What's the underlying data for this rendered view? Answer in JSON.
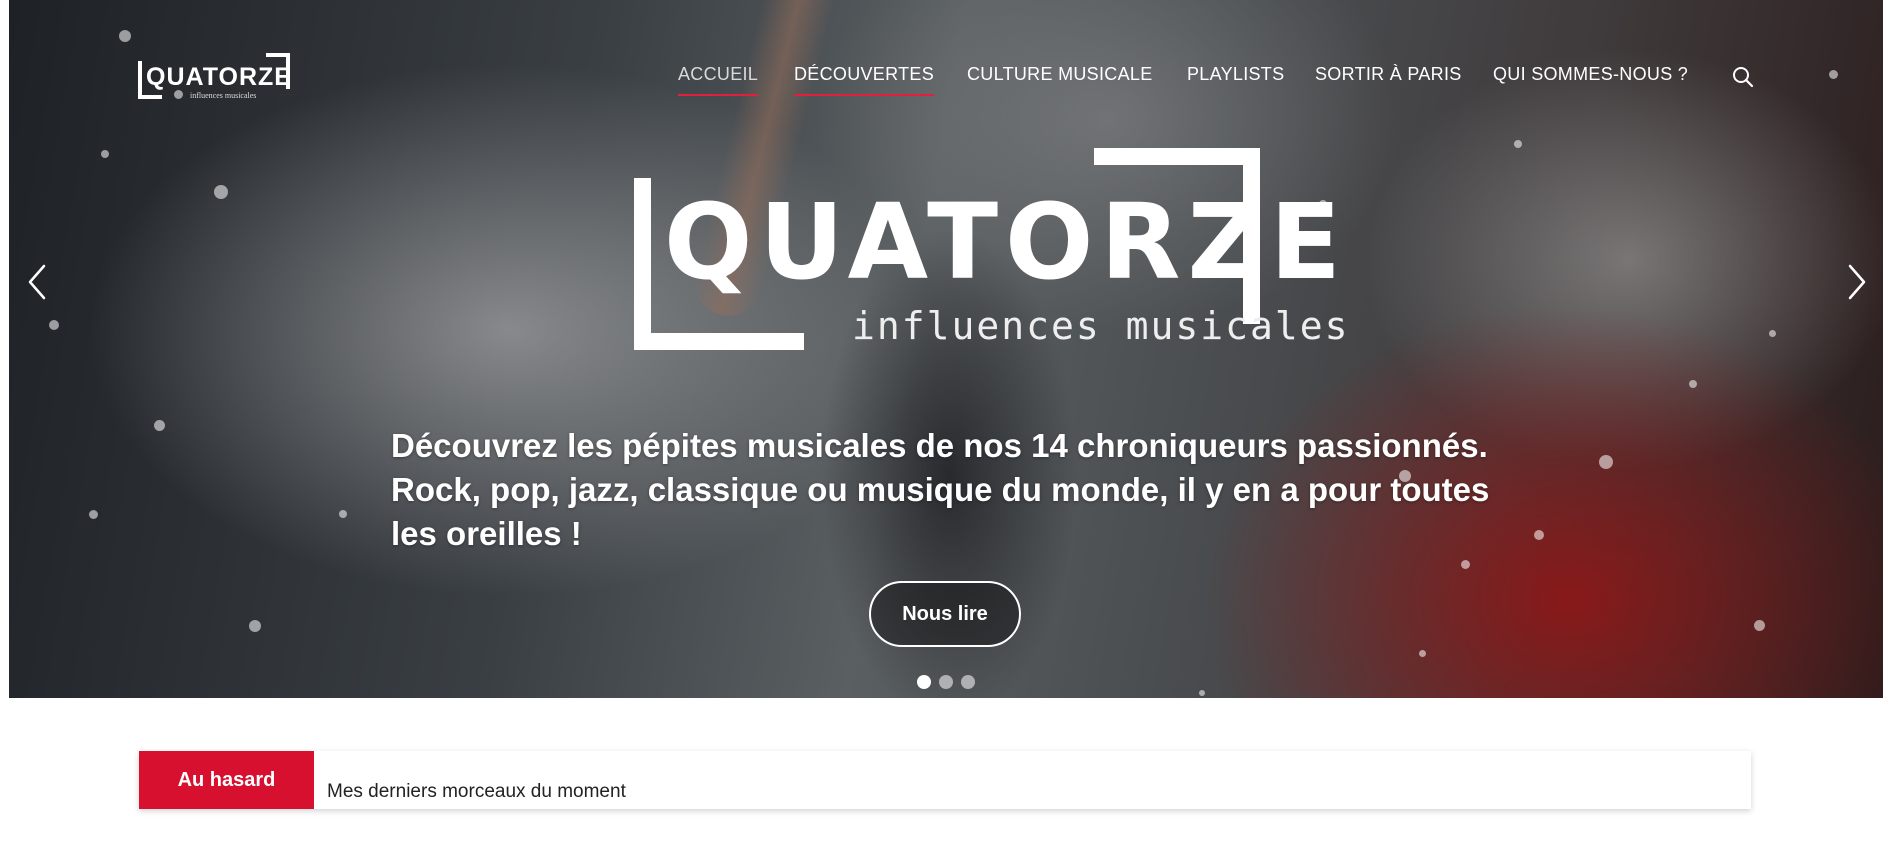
{
  "site": {
    "logo_text": "QUATORZE",
    "logo_subtitle": "influences musicales"
  },
  "nav": {
    "items": [
      {
        "label": "ACCUEIL",
        "active": true
      },
      {
        "label": "DÉCOUVERTES",
        "active": false
      },
      {
        "label": "CULTURE MUSICALE",
        "active": false
      },
      {
        "label": "PLAYLISTS",
        "active": false
      },
      {
        "label": "SORTIR À PARIS",
        "active": false
      },
      {
        "label": "QUI SOMMES-NOUS ?",
        "active": false
      }
    ],
    "search_icon": "search-icon"
  },
  "hero": {
    "logo_text": "QUATORZE",
    "logo_subtitle": "influences musicales",
    "tagline": "Découvrez les pépites musicales de nos 14 chroniqueurs passionnés. Rock, pop, jazz, classique ou musique du monde, il y en a pour toutes les oreilles !",
    "cta_label": "Nous lire",
    "slides_total": 3,
    "active_slide": 1,
    "prev_icon": "chevron-left-icon",
    "next_icon": "chevron-right-icon"
  },
  "random": {
    "label": "Au hasard",
    "link": "Mes derniers morceaux du moment"
  },
  "colors": {
    "accent": "#d6102e",
    "underline": "#e0203c",
    "text_light": "#ffffff"
  }
}
